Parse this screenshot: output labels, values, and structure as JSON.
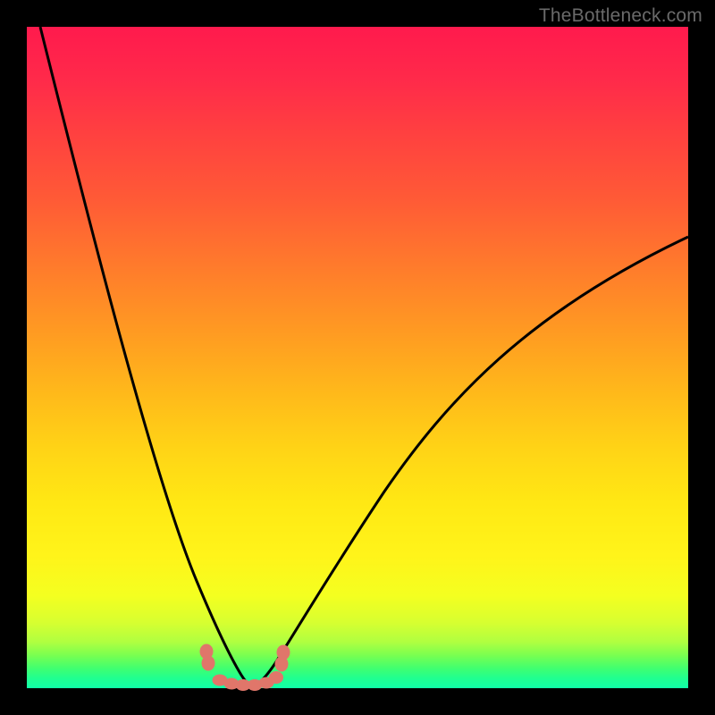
{
  "watermark": "TheBottleneck.com",
  "chart_data": {
    "type": "line",
    "title": "",
    "xlabel": "",
    "ylabel": "",
    "xlim": [
      0,
      100
    ],
    "ylim": [
      0,
      100
    ],
    "series": [
      {
        "name": "curve-left",
        "x": [
          2,
          5,
          9,
          13,
          17,
          21,
          24,
          26,
          28,
          29,
          30,
          31,
          32,
          33,
          34
        ],
        "values": [
          100,
          88,
          74,
          60,
          46,
          32,
          20,
          12,
          6,
          3,
          1.5,
          0.8,
          0.4,
          0.2,
          0.1
        ]
      },
      {
        "name": "curve-right",
        "x": [
          34,
          35,
          36,
          37,
          38,
          40,
          43,
          47,
          52,
          58,
          65,
          73,
          82,
          91,
          100
        ],
        "values": [
          0.1,
          0.3,
          0.8,
          1.8,
          3.2,
          7,
          13,
          21,
          30,
          38,
          46,
          53,
          59,
          64,
          68
        ]
      },
      {
        "name": "bottom-marks",
        "x": [
          27,
          27.3,
          29,
          30.5,
          32,
          33,
          34.5,
          37,
          38,
          38.3
        ],
        "values": [
          5.5,
          3.8,
          1.0,
          0.6,
          0.5,
          0.5,
          0.6,
          1.4,
          3.6,
          5.2
        ]
      }
    ],
    "colors": {
      "curve": "#000000",
      "marks": "#e0766a"
    }
  }
}
